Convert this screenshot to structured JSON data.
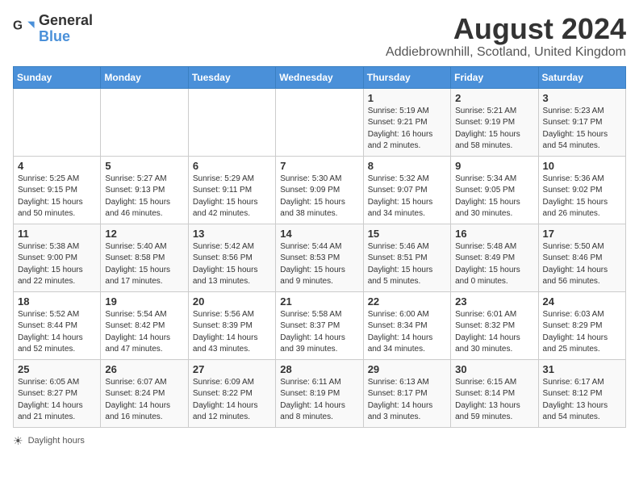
{
  "header": {
    "logo_general": "General",
    "logo_blue": "Blue",
    "title": "August 2024",
    "subtitle": "Addiebrownhill, Scotland, United Kingdom"
  },
  "calendar": {
    "weekdays": [
      "Sunday",
      "Monday",
      "Tuesday",
      "Wednesday",
      "Thursday",
      "Friday",
      "Saturday"
    ],
    "weeks": [
      [
        {
          "day": "",
          "info": ""
        },
        {
          "day": "",
          "info": ""
        },
        {
          "day": "",
          "info": ""
        },
        {
          "day": "",
          "info": ""
        },
        {
          "day": "1",
          "info": "Sunrise: 5:19 AM\nSunset: 9:21 PM\nDaylight: 16 hours\nand 2 minutes."
        },
        {
          "day": "2",
          "info": "Sunrise: 5:21 AM\nSunset: 9:19 PM\nDaylight: 15 hours\nand 58 minutes."
        },
        {
          "day": "3",
          "info": "Sunrise: 5:23 AM\nSunset: 9:17 PM\nDaylight: 15 hours\nand 54 minutes."
        }
      ],
      [
        {
          "day": "4",
          "info": "Sunrise: 5:25 AM\nSunset: 9:15 PM\nDaylight: 15 hours\nand 50 minutes."
        },
        {
          "day": "5",
          "info": "Sunrise: 5:27 AM\nSunset: 9:13 PM\nDaylight: 15 hours\nand 46 minutes."
        },
        {
          "day": "6",
          "info": "Sunrise: 5:29 AM\nSunset: 9:11 PM\nDaylight: 15 hours\nand 42 minutes."
        },
        {
          "day": "7",
          "info": "Sunrise: 5:30 AM\nSunset: 9:09 PM\nDaylight: 15 hours\nand 38 minutes."
        },
        {
          "day": "8",
          "info": "Sunrise: 5:32 AM\nSunset: 9:07 PM\nDaylight: 15 hours\nand 34 minutes."
        },
        {
          "day": "9",
          "info": "Sunrise: 5:34 AM\nSunset: 9:05 PM\nDaylight: 15 hours\nand 30 minutes."
        },
        {
          "day": "10",
          "info": "Sunrise: 5:36 AM\nSunset: 9:02 PM\nDaylight: 15 hours\nand 26 minutes."
        }
      ],
      [
        {
          "day": "11",
          "info": "Sunrise: 5:38 AM\nSunset: 9:00 PM\nDaylight: 15 hours\nand 22 minutes."
        },
        {
          "day": "12",
          "info": "Sunrise: 5:40 AM\nSunset: 8:58 PM\nDaylight: 15 hours\nand 17 minutes."
        },
        {
          "day": "13",
          "info": "Sunrise: 5:42 AM\nSunset: 8:56 PM\nDaylight: 15 hours\nand 13 minutes."
        },
        {
          "day": "14",
          "info": "Sunrise: 5:44 AM\nSunset: 8:53 PM\nDaylight: 15 hours\nand 9 minutes."
        },
        {
          "day": "15",
          "info": "Sunrise: 5:46 AM\nSunset: 8:51 PM\nDaylight: 15 hours\nand 5 minutes."
        },
        {
          "day": "16",
          "info": "Sunrise: 5:48 AM\nSunset: 8:49 PM\nDaylight: 15 hours\nand 0 minutes."
        },
        {
          "day": "17",
          "info": "Sunrise: 5:50 AM\nSunset: 8:46 PM\nDaylight: 14 hours\nand 56 minutes."
        }
      ],
      [
        {
          "day": "18",
          "info": "Sunrise: 5:52 AM\nSunset: 8:44 PM\nDaylight: 14 hours\nand 52 minutes."
        },
        {
          "day": "19",
          "info": "Sunrise: 5:54 AM\nSunset: 8:42 PM\nDaylight: 14 hours\nand 47 minutes."
        },
        {
          "day": "20",
          "info": "Sunrise: 5:56 AM\nSunset: 8:39 PM\nDaylight: 14 hours\nand 43 minutes."
        },
        {
          "day": "21",
          "info": "Sunrise: 5:58 AM\nSunset: 8:37 PM\nDaylight: 14 hours\nand 39 minutes."
        },
        {
          "day": "22",
          "info": "Sunrise: 6:00 AM\nSunset: 8:34 PM\nDaylight: 14 hours\nand 34 minutes."
        },
        {
          "day": "23",
          "info": "Sunrise: 6:01 AM\nSunset: 8:32 PM\nDaylight: 14 hours\nand 30 minutes."
        },
        {
          "day": "24",
          "info": "Sunrise: 6:03 AM\nSunset: 8:29 PM\nDaylight: 14 hours\nand 25 minutes."
        }
      ],
      [
        {
          "day": "25",
          "info": "Sunrise: 6:05 AM\nSunset: 8:27 PM\nDaylight: 14 hours\nand 21 minutes."
        },
        {
          "day": "26",
          "info": "Sunrise: 6:07 AM\nSunset: 8:24 PM\nDaylight: 14 hours\nand 16 minutes."
        },
        {
          "day": "27",
          "info": "Sunrise: 6:09 AM\nSunset: 8:22 PM\nDaylight: 14 hours\nand 12 minutes."
        },
        {
          "day": "28",
          "info": "Sunrise: 6:11 AM\nSunset: 8:19 PM\nDaylight: 14 hours\nand 8 minutes."
        },
        {
          "day": "29",
          "info": "Sunrise: 6:13 AM\nSunset: 8:17 PM\nDaylight: 14 hours\nand 3 minutes."
        },
        {
          "day": "30",
          "info": "Sunrise: 6:15 AM\nSunset: 8:14 PM\nDaylight: 13 hours\nand 59 minutes."
        },
        {
          "day": "31",
          "info": "Sunrise: 6:17 AM\nSunset: 8:12 PM\nDaylight: 13 hours\nand 54 minutes."
        }
      ]
    ]
  },
  "footer": {
    "daylight_hours_label": "Daylight hours"
  }
}
